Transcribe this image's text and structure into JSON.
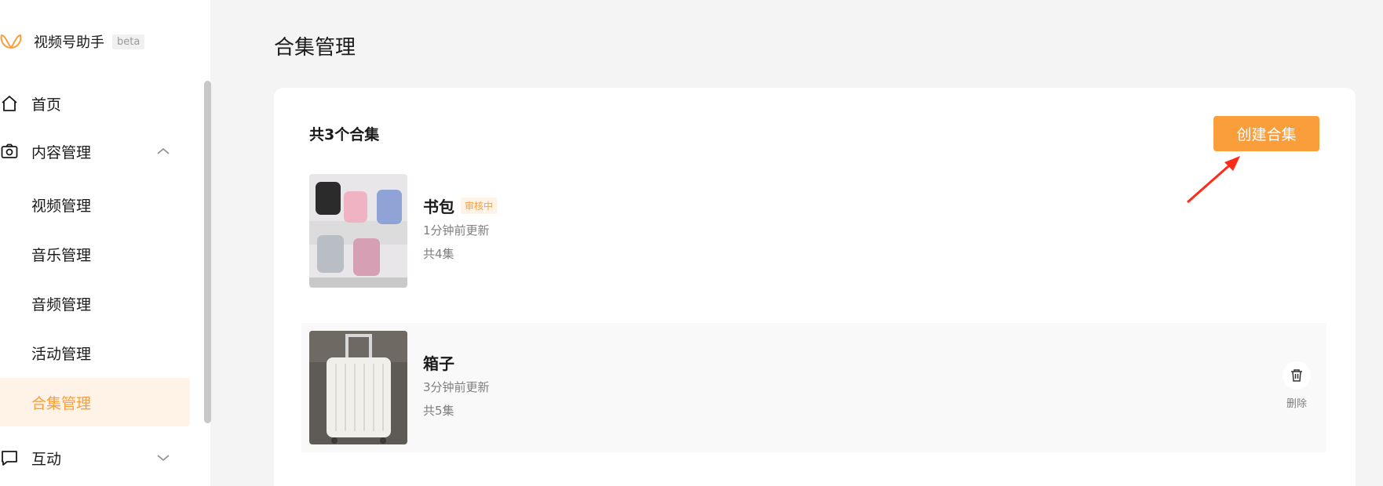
{
  "sidebar": {
    "brand_name": "视频号助手",
    "brand_tag": "beta",
    "nav": [
      {
        "label": "首页",
        "icon": "home-icon"
      },
      {
        "label": "内容管理",
        "icon": "camera-icon"
      },
      {
        "label": "互动",
        "icon": "chat-icon"
      }
    ],
    "content_sub": [
      {
        "label": "视频管理"
      },
      {
        "label": "音乐管理"
      },
      {
        "label": "音频管理"
      },
      {
        "label": "活动管理"
      },
      {
        "label": "合集管理"
      }
    ],
    "active_item": "合集管理"
  },
  "main": {
    "page_title": "合集管理",
    "count_label": "共3个合集",
    "create_button": "创建合集",
    "collections": [
      {
        "title": "书包",
        "status": "审核中",
        "updated": "1分钟前更新",
        "episodes": "共4集"
      },
      {
        "title": "箱子",
        "updated": "3分钟前更新",
        "episodes": "共5集",
        "delete_label": "删除"
      }
    ]
  },
  "colors": {
    "accent": "#fa9d3b",
    "accent_light": "#fff3e7",
    "annotation_arrow": "#ff2a1a"
  }
}
